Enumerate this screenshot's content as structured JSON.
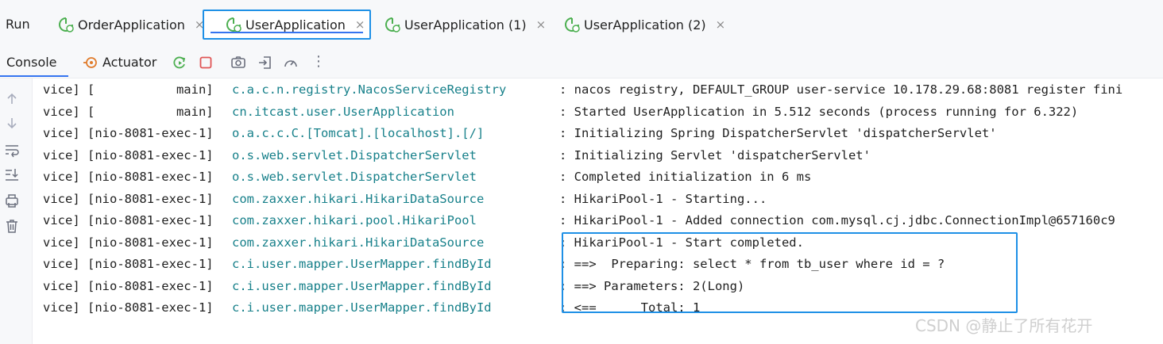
{
  "run_panel": {
    "title": "Run",
    "tabs": [
      {
        "label": "OrderApplication",
        "icon": "spring-boot-app-icon",
        "active": false
      },
      {
        "label": "UserApplication",
        "icon": "spring-boot-app-icon",
        "active": true
      },
      {
        "label": "UserApplication (1)",
        "icon": "spring-boot-app-icon",
        "active": false
      },
      {
        "label": "UserApplication (2)",
        "icon": "spring-boot-app-icon",
        "active": false
      }
    ],
    "close_glyph": "×"
  },
  "toolbar": {
    "console_tab": "Console",
    "actuator_tab": "Actuator",
    "icons": [
      "actuator-icon",
      "rerun-icon",
      "stop-icon",
      "screenshot-icon",
      "export-icon",
      "profiler-icon",
      "more-icon"
    ],
    "more_glyph": "⋮"
  },
  "gutter_icons": [
    "scroll-up-icon",
    "scroll-down-icon",
    "soft-wrap-icon",
    "scroll-to-end-icon",
    "print-icon",
    "clear-icon"
  ],
  "log_lines": [
    {
      "prefix": "vice] [           main]",
      "logger": "c.a.c.n.registry.NacosServiceRegistry",
      "message": ": nacos registry, DEFAULT_GROUP user-service 10.178.29.68:8081 register fini"
    },
    {
      "prefix": "vice] [           main]",
      "logger": "cn.itcast.user.UserApplication",
      "message": ": Started UserApplication in 5.512 seconds (process running for 6.322)"
    },
    {
      "prefix": "vice] [nio-8081-exec-1]",
      "logger": "o.a.c.c.C.[Tomcat].[localhost].[/]",
      "message": ": Initializing Spring DispatcherServlet 'dispatcherServlet'"
    },
    {
      "prefix": "vice] [nio-8081-exec-1]",
      "logger": "o.s.web.servlet.DispatcherServlet",
      "message": ": Initializing Servlet 'dispatcherServlet'"
    },
    {
      "prefix": "vice] [nio-8081-exec-1]",
      "logger": "o.s.web.servlet.DispatcherServlet",
      "message": ": Completed initialization in 6 ms"
    },
    {
      "prefix": "vice] [nio-8081-exec-1]",
      "logger": "com.zaxxer.hikari.HikariDataSource",
      "message": ": HikariPool-1 - Starting..."
    },
    {
      "prefix": "vice] [nio-8081-exec-1]",
      "logger": "com.zaxxer.hikari.pool.HikariPool",
      "message": ": HikariPool-1 - Added connection com.mysql.cj.jdbc.ConnectionImpl@657160c9"
    },
    {
      "prefix": "vice] [nio-8081-exec-1]",
      "logger": "com.zaxxer.hikari.HikariDataSource",
      "message": ": HikariPool-1 - Start completed."
    },
    {
      "prefix": "vice] [nio-8081-exec-1]",
      "logger": "c.i.user.mapper.UserMapper.findById",
      "message": ": ==>  Preparing: select * from tb_user where id = ?"
    },
    {
      "prefix": "vice] [nio-8081-exec-1]",
      "logger": "c.i.user.mapper.UserMapper.findById",
      "message": ": ==> Parameters: 2(Long)"
    },
    {
      "prefix": "vice] [nio-8081-exec-1]",
      "logger": "c.i.user.mapper.UserMapper.findById",
      "message": ": <==      Total: 1"
    }
  ],
  "watermark": "CSDN @静止了所有花开",
  "colors": {
    "accent": "#3574f0",
    "highlight_box": "#1e90e6",
    "logger_text": "#17808a",
    "spring_green": "#4caf50",
    "stop_red": "#e05555"
  }
}
